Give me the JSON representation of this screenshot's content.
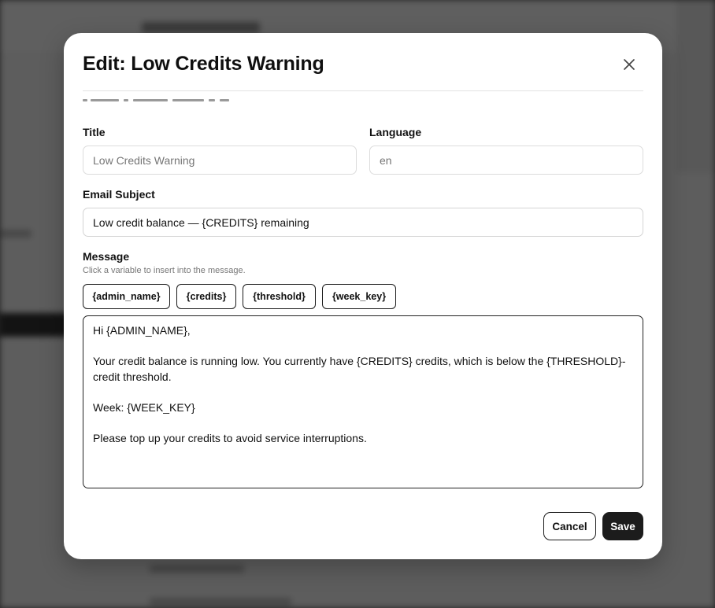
{
  "modal": {
    "title": "Edit: Low Credits Warning",
    "close_icon": "close-icon"
  },
  "form": {
    "title": {
      "label": "Title",
      "placeholder": "Low Credits Warning"
    },
    "language": {
      "label": "Language",
      "placeholder": "en"
    },
    "email_subject": {
      "label": "Email Subject",
      "value": "Low credit balance — {CREDITS} remaining"
    },
    "message": {
      "label": "Message",
      "helper": "Click a variable to insert into the message.",
      "variables": [
        "{admin_name}",
        "{credits}",
        "{threshold}",
        "{week_key}"
      ],
      "lines": [
        "Hi {ADMIN_NAME},",
        "",
        "Your credit balance is running low. You currently have {CREDITS} credits, which is below the {THRESHOLD}-credit threshold.",
        "",
        "Week: {WEEK_KEY}",
        "",
        "Please top up your credits to avoid service interruptions."
      ]
    }
  },
  "footer": {
    "cancel_label": "Cancel",
    "save_label": "Save"
  },
  "colors": {
    "primary_button": "#1c1c1c",
    "overlay": "#5c5c5c"
  }
}
